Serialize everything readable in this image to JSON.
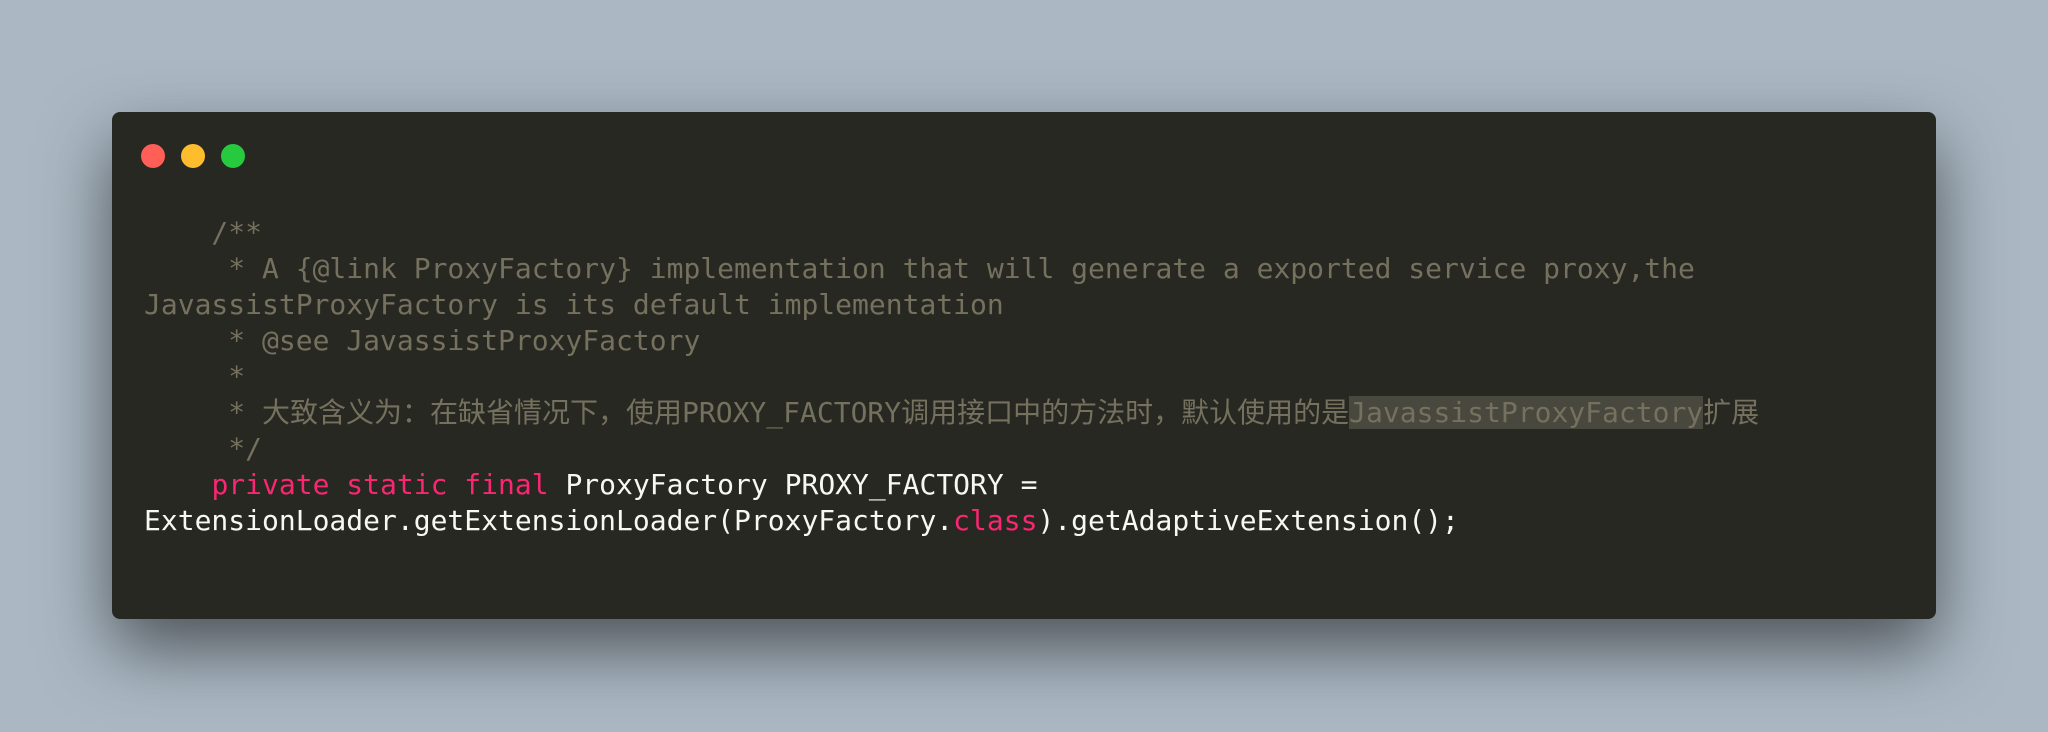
{
  "colors": {
    "background": "#abb8c3",
    "editor_background": "#272822",
    "comment": "#75715e",
    "keyword": "#f92672",
    "text": "#f8f8f2",
    "highlight": "#49483e",
    "close_button": "#ff5f56",
    "minimize_button": "#ffbd2e",
    "zoom_button": "#27c93f"
  },
  "code": {
    "l1": "    /**",
    "l2": "     * A {@link ProxyFactory} implementation that will generate a exported service proxy,the",
    "l3": "JavassistProxyFactory is its default implementation",
    "l4": "     * @see JavassistProxyFactory",
    "l5": "     *",
    "l6_pre": "     * 大致含义为：在缺省情况下，使用PROXY_FACTORY调用接口中的方法时，默认使用的是",
    "l6_hl": "JavassistProxyFactory",
    "l6_post": "扩展",
    "l7": "     */",
    "l8_indent": "    ",
    "l8_kw": "private static final",
    "l8_rest": " ProxyFactory PROXY_FACTORY =",
    "l9_pre": "ExtensionLoader.getExtensionLoader(ProxyFactory.",
    "l9_kw": "class",
    "l9_post": ").getAdaptiveExtension();"
  }
}
